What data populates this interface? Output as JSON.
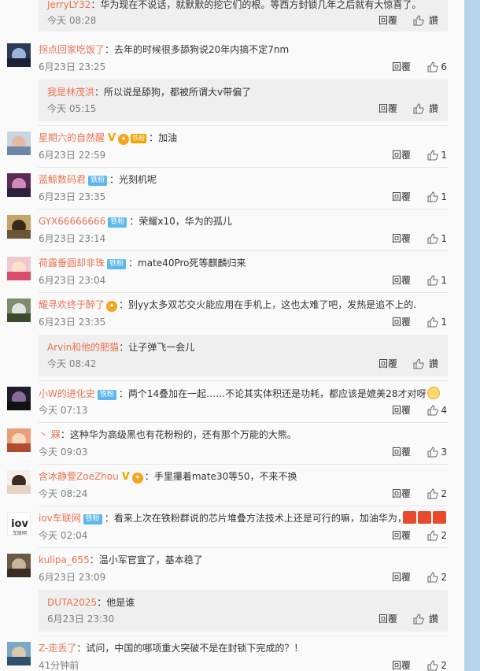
{
  "colors": {
    "username": "#eb7350",
    "badge": "#5cb6ef",
    "vip": "#f4a200",
    "panel_bg": "#fafafa",
    "sub_bg": "#efefef",
    "page_bg": "#b6d4ec"
  },
  "icons": {
    "like": "thumbs-up-icon"
  },
  "labels": {
    "reply": "回覆",
    "zan": "讚",
    "colon": "：",
    "fan_badge": "铁粉"
  },
  "top_subreply": {
    "user": "JerryLY32",
    "text": "华为现在不说话，就默默的挖它们的根。等西方封锁几年之后就有大惊喜了。",
    "time": "今天 08:28"
  },
  "comments": [
    {
      "user": "拐点回家吃饭了",
      "text": "去年的时候很多舔狗说20年内搞不定7nm",
      "time": "6月23日 23:25",
      "likes": "6"
    },
    {
      "user": "星期六的自然醒",
      "text": "加油",
      "time": "6月23日 22:59",
      "likes": "1"
    },
    {
      "user": "蓝鲸数码君",
      "text": "光刻机呢",
      "time": "6月23日 23:35",
      "likes": "1"
    },
    {
      "user": "GYX66666666",
      "text": "荣耀x10，华为的孤儿",
      "time": "6月23日 23:14",
      "likes": "1"
    },
    {
      "user": "荷露垂圆却非珠",
      "text": "mate40Pro死等麒麟归来",
      "time": "6月23日 23:04",
      "likes": "1"
    },
    {
      "user": "耀寻欢终于醉了",
      "text": "别yy太多双芯交火能应用在手机上，这也太难了吧，发热是追不上的.",
      "time": "6月23日 23:35",
      "likes": "1"
    },
    {
      "user": "小W的进化史",
      "text": "两个14叠加在一起……不论其实体积还是功耗，都应该是媲美28才对呀",
      "time": "今天 07:13",
      "likes": "4"
    },
    {
      "user": "丶 槑",
      "text": "这种华为高级黑也有花粉粉的，还有那个万能的大熊。",
      "time": "今天 09:03",
      "likes": "3"
    },
    {
      "user": "含冰静萱ZoeZhou",
      "text": "手里攥着mate30等50，不来不换",
      "time": "今天 08:24",
      "likes": "2"
    },
    {
      "user": "iov车联网",
      "text": "看来上次在铁粉群说的芯片堆叠方法技术上还是可行的嘛，加油华为，",
      "time": "今天 02:04",
      "likes": "2",
      "avatar_text": "iov",
      "avatar_sub": "车联网"
    },
    {
      "user": "kulipa_655",
      "text": "温小军官宣了，基本稳了",
      "time": "6月23日 23:09",
      "likes": "2"
    },
    {
      "user": "Z-走丢了",
      "text": "试问，中国的哪项重大突破不是在封锁下完成的？！",
      "time": "41分钟前",
      "likes": "2"
    }
  ],
  "subreplies": [
    {
      "user": "我是林茂洪",
      "text": "所以说是舔狗，都被所谓大v带偏了",
      "time": "今天 05:15"
    },
    {
      "user": "Arvin和他的肥猫",
      "text": "让子弹飞一会儿",
      "time": "今天 08:42"
    },
    {
      "user": "DUTA2025",
      "text": "他是谁",
      "time": "6月23日 23:30"
    }
  ],
  "emojis": {
    "medal_label": "铁粉",
    "fire_text": "奋斗"
  }
}
